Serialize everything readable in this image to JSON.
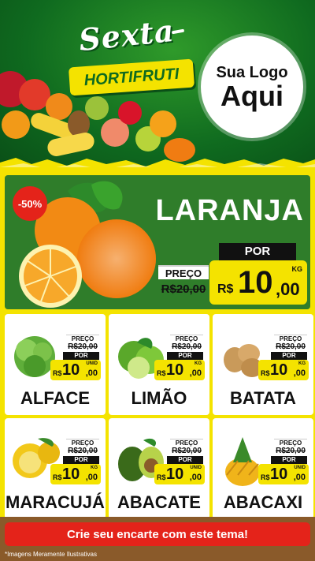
{
  "header": {
    "title": "Sexta",
    "banner": "HORTIFRUTI",
    "logo_line1": "Sua Logo",
    "logo_line2": "Aqui"
  },
  "hero": {
    "discount": "-50%",
    "name": "LARANJA",
    "preco_label": "PREÇO",
    "old_price": "R$20,00",
    "por_label": "POR",
    "currency": "R$",
    "price_int": "10",
    "price_dec": ",00",
    "unit": "KG"
  },
  "cards": [
    {
      "name": "ALFACE",
      "preco_label": "PREÇO",
      "old_price": "R$20,00",
      "por_label": "POR",
      "currency": "R$",
      "price_int": "10",
      "price_dec": ",00",
      "unit": "UNID",
      "icon": "lettuce-icon"
    },
    {
      "name": "LIMÃO",
      "preco_label": "PREÇO",
      "old_price": "R$20,00",
      "por_label": "POR",
      "currency": "R$",
      "price_int": "10",
      "price_dec": ",00",
      "unit": "KG",
      "icon": "lime-icon"
    },
    {
      "name": "BATATA",
      "preco_label": "PREÇO",
      "old_price": "R$20,00",
      "por_label": "POR",
      "currency": "R$",
      "price_int": "10",
      "price_dec": ",00",
      "unit": "KG",
      "icon": "potato-icon"
    },
    {
      "name": "MARACUJÁ",
      "preco_label": "PREÇO",
      "old_price": "R$20,00",
      "por_label": "POR",
      "currency": "R$",
      "price_int": "10",
      "price_dec": ",00",
      "unit": "KG",
      "icon": "passion-fruit-icon"
    },
    {
      "name": "ABACATE",
      "preco_label": "PREÇO",
      "old_price": "R$20,00",
      "por_label": "POR",
      "currency": "R$",
      "price_int": "10",
      "price_dec": ",00",
      "unit": "UNID",
      "icon": "avocado-icon"
    },
    {
      "name": "ABACAXI",
      "preco_label": "PREÇO",
      "old_price": "R$20,00",
      "por_label": "POR",
      "currency": "R$",
      "price_int": "10",
      "price_dec": ",00",
      "unit": "UNID",
      "icon": "pineapple-icon"
    }
  ],
  "footer": {
    "cta": "Crie seu encarte com este tema!",
    "note": "*Imagens Meramente Ilustrativas"
  },
  "colors": {
    "green_dark": "#0f6a1f",
    "green_hero": "#2f7d2a",
    "yellow": "#f4e300",
    "red": "#e4231a"
  }
}
